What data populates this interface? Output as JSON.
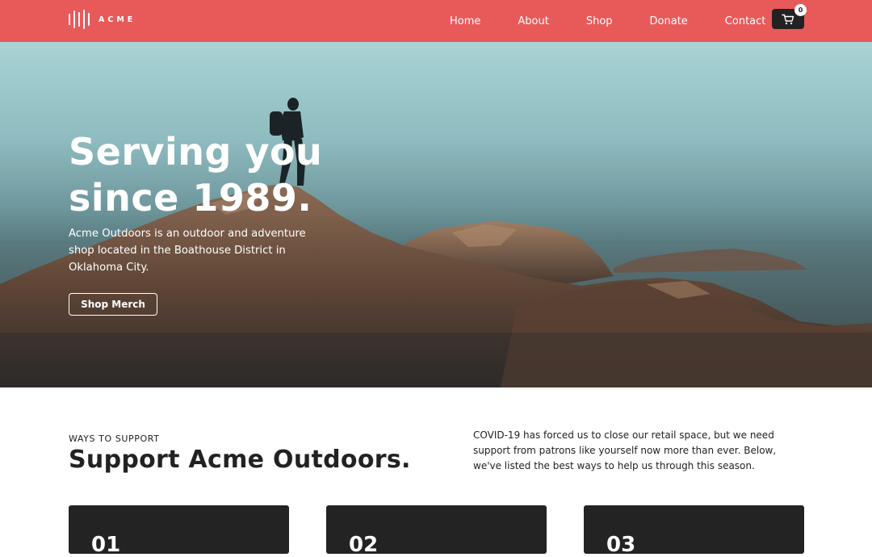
{
  "brand": {
    "name": "ACME"
  },
  "nav": {
    "links": [
      "Home",
      "About",
      "Shop",
      "Donate",
      "Contact"
    ],
    "cart_count": "0"
  },
  "hero": {
    "title_line1": "Serving you",
    "title_line2": "since 1989.",
    "description": "Acme Outdoors is an outdoor and adventure shop located in the Boathouse District in Oklahoma City.",
    "button_label": "Shop Merch"
  },
  "support": {
    "eyebrow": "WAYS TO SUPPORT",
    "heading": "Support Acme Outdoors.",
    "copy": "COVID-19 has forced us to close our retail space, but we need support from patrons like yourself now more than ever. Below, we've listed the best ways to help us through this season.",
    "cards": [
      "01",
      "02",
      "03"
    ]
  },
  "colors": {
    "nav_bg": "#e85a5a",
    "dark": "#232323",
    "white": "#ffffff"
  },
  "icons": {
    "logo": "soundwave-logo-icon",
    "cart": "shopping-cart-icon"
  }
}
